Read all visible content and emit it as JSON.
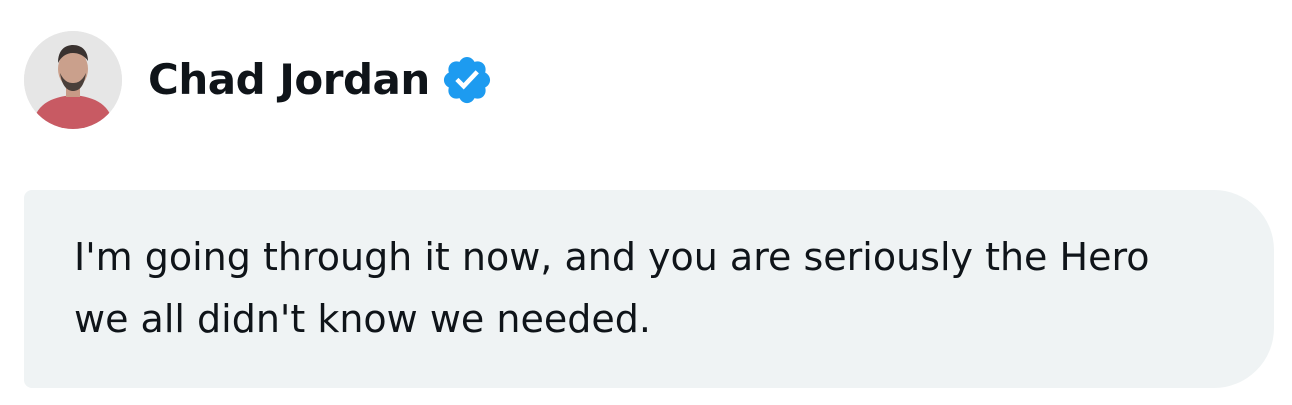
{
  "author": {
    "name": "Chad Jordan",
    "verified": true,
    "avatar_icon": "person-photo",
    "verified_icon": "verified-badge-icon",
    "verified_color": "#1d9bf0"
  },
  "message": {
    "text": "I'm going through it now, and you are seriously the Hero we all didn't know we needed.",
    "bubble_color": "#eff3f4"
  }
}
